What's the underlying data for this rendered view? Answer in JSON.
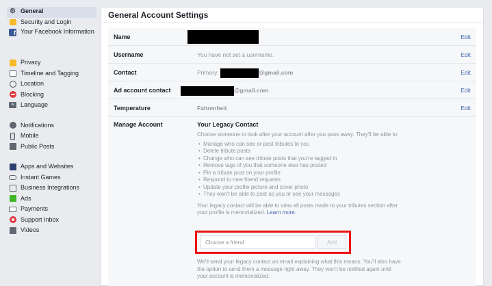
{
  "sidebar": {
    "groups": [
      [
        {
          "label": "General",
          "icon": "gear-icon",
          "active": true
        },
        {
          "label": "Security and Login",
          "icon": "badge-icon"
        },
        {
          "label": "Your Facebook Information",
          "icon": "facebook-icon"
        }
      ],
      [
        {
          "label": "Privacy",
          "icon": "lock-icon"
        },
        {
          "label": "Timeline and Tagging",
          "icon": "timeline-icon"
        },
        {
          "label": "Location",
          "icon": "location-icon"
        },
        {
          "label": "Blocking",
          "icon": "blocking-icon"
        },
        {
          "label": "Language",
          "icon": "language-icon"
        }
      ],
      [
        {
          "label": "Notifications",
          "icon": "globe-icon"
        },
        {
          "label": "Mobile",
          "icon": "mobile-icon"
        },
        {
          "label": "Public Posts",
          "icon": "rss-icon"
        }
      ],
      [
        {
          "label": "Apps and Websites",
          "icon": "apps-icon"
        },
        {
          "label": "Instant Games",
          "icon": "gamepad-icon"
        },
        {
          "label": "Business Integrations",
          "icon": "business-icon"
        },
        {
          "label": "Ads",
          "icon": "ads-icon"
        },
        {
          "label": "Payments",
          "icon": "card-icon"
        },
        {
          "label": "Support Inbox",
          "icon": "lifebuoy-icon"
        },
        {
          "label": "Videos",
          "icon": "film-icon"
        }
      ]
    ]
  },
  "main": {
    "title": "General Account Settings",
    "rows": {
      "name": {
        "label": "Name",
        "edit": "Edit"
      },
      "username": {
        "label": "Username",
        "value": "You have not set a username.",
        "edit": "Edit"
      },
      "contact": {
        "label": "Contact",
        "prefix": "Primary:",
        "suffix": "@gmail.com",
        "edit": "Edit"
      },
      "ad_contact": {
        "label": "Ad account contact",
        "suffix": "@gmail.com",
        "edit": "Edit"
      },
      "temperature": {
        "label": "Temperature",
        "value": "Fahrenheit",
        "edit": "Edit"
      }
    },
    "manage": {
      "label": "Manage Account",
      "heading": "Your Legacy Contact",
      "intro": "Choose someone to look after your account after you pass away. They'll be able to:",
      "bullets": [
        "Manage who can see or post tributes to you",
        "Delete tribute posts",
        "Change who can see tribute posts that you're tagged in",
        "Remove tags of you that someone else has posted",
        "Pin a tribute post on your profile",
        "Respond to new friend requests",
        "Update your profile picture and cover photo",
        "They won't be able to post as you or see your messages"
      ],
      "memorial_text": "Your legacy contact will be able to view all posts made to your tributes section after your profile is memorialized.",
      "learn_more": "Learn more.",
      "friend_placeholder": "Choose a friend",
      "add_label": "Add",
      "note": "We'll send your legacy contact an email explaining what this means. You'll also have the option to send them a message right away. They won't be notified again until your account is memorialized."
    }
  },
  "colors": {
    "link": "#4267b2",
    "highlight_border": "#ee1111",
    "active_bg": "#d8dfea"
  }
}
